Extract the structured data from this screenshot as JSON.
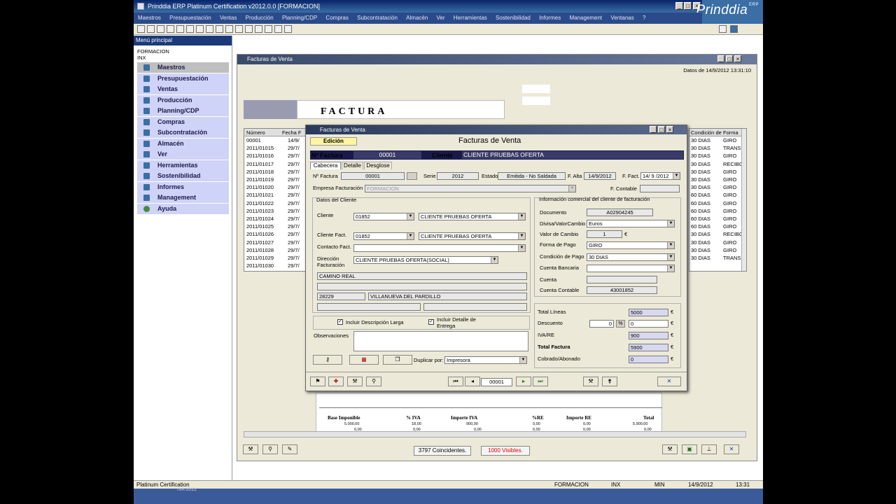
{
  "window": {
    "title": "Prinddia ERP Platinum Certification v2012.0.0 [FORMACION]"
  },
  "logo": {
    "text": "Prinddia",
    "sup": "ERP"
  },
  "menubar": [
    "Maestros",
    "Presupuestación",
    "Ventas",
    "Producción",
    "Planning/CDP",
    "Compras",
    "Subcontratación",
    "Almacén",
    "Ver",
    "Herramientas",
    "Sostenibilidad",
    "Informes",
    "Management",
    "Ventanas",
    "?"
  ],
  "sidemenu": {
    "header": "Menú principal",
    "company": "FORMACION",
    "user": "INX",
    "items": [
      "Maestros",
      "Presupuestación",
      "Ventas",
      "Producción",
      "Planning/CDP",
      "Compras",
      "Subcontratación",
      "Almacén",
      "Ver",
      "Herramientas",
      "Sostenibilidad",
      "Informes",
      "Management",
      "Ayuda"
    ]
  },
  "facturas_window": {
    "title": "Facturas de Venta",
    "date_label": "Datos de 14/9/2012 13:31:10",
    "doc_heading": "FACTURA",
    "columns": {
      "numero": "Número",
      "fecha": "Fecha F",
      "condicion": "Condición de",
      "forma": "Forma"
    },
    "numeros": [
      "00001",
      "2011/01015",
      "2011/01016",
      "2011/01017",
      "2011/01018",
      "2011/01019",
      "2011/01020",
      "2011/01021",
      "2011/01022",
      "2011/01023",
      "2011/01024",
      "2011/01025",
      "2011/01026",
      "2011/01027",
      "2011/01028",
      "2011/01029",
      "2011/01030"
    ],
    "fechas": [
      "14/9/",
      "29/7/",
      "29/7/",
      "29/7/",
      "29/7/",
      "29/7/",
      "29/7/",
      "29/7/",
      "29/7/",
      "29/7/",
      "29/7/",
      "29/7/",
      "29/7/",
      "29/7/",
      "29/7/",
      "29/7/",
      "29/7/"
    ],
    "condiciones": [
      "30 DIAS",
      "30 DIAS",
      "30 DIAS",
      "30 DIAS",
      "30 DIAS",
      "30 DIAS",
      "30 DIAS",
      "60 DIAS",
      "60 DIAS",
      "60 DIAS",
      "60 DIAS",
      "60 DIAS",
      "30 DIAS",
      "30 DIAS",
      "30 DIAS",
      "30 DIAS"
    ],
    "formas": [
      "GIRO",
      "TRANS",
      "GIRO",
      "RECIBO",
      "GIRO",
      "GIRO",
      "GIRO",
      "GIRO",
      "GIRO",
      "GIRO",
      "GIRO",
      "GIRO",
      "RECIBO",
      "GIRO",
      "GIRO",
      "TRANS"
    ],
    "totals": {
      "headers": [
        "Base Imponible",
        "% IVA",
        "Importe IVA",
        "%RE",
        "Importe RE",
        "Total"
      ],
      "row1": [
        "5.000,00",
        "18,00",
        "900,00",
        "0,00",
        "0,00",
        "5.900,00"
      ],
      "row2": [
        "0,00",
        "0,00",
        "0,00",
        "0,00",
        "0,00",
        "0,00"
      ]
    },
    "coincidentes": "3797 Coincidentes.",
    "visibles": "1000 Visibles."
  },
  "dialog": {
    "title": "Facturas de Venta",
    "header_title": "Facturas de Venta",
    "mode": "Edición",
    "nfactura_label": "Nº Factura",
    "nfactura": "00001",
    "cliente_label": "Cliente",
    "cliente": "CLIENTE PRUEBAS OFERTA",
    "tabs": [
      "Cabecera",
      "Detalle",
      "Desglose"
    ],
    "fields": {
      "nfactura_label": "Nº Factura",
      "nfactura": "00001",
      "serie_label": "Serie",
      "serie": "2012",
      "estado_label": "Estado",
      "estado": "Emitida - No Saldada",
      "falta_label": "F. Alta",
      "falta": "14/9/2012",
      "ffact_label": "F. Fact.",
      "ffact": "14/ 9 /2012",
      "empresa_label": "Empresa Facturación",
      "empresa": "FORMACION",
      "fcontable_label": "F. Contable"
    },
    "datos_cliente": {
      "title": "Datos del Cliente",
      "cliente_label": "Cliente",
      "cliente_code": "01852",
      "cliente_name": "CLIENTE PRUEBAS OFERTA",
      "clientefact_label": "Cliente Fact.",
      "clientefact_code": "01852",
      "clientefact_name": "CLIENTE PRUEBAS OFERTA",
      "contacto_label": "Contacto Fact.",
      "direccion_label1": "Dirección",
      "direccion_label2": "Facturación",
      "direccion": "CLIENTE PRUEBAS OFERTA(SOCIAL)",
      "calle": "CAMINO REAL",
      "cp": "28229",
      "poblacion": "VILLANUEVA DEL PARDILLO"
    },
    "info_comercial": {
      "title": "Información comercial del cliente de facturación",
      "documento_label": "Documento",
      "documento": "A02904245",
      "divisa_label": "Divisa/ValorCambio",
      "divisa": "Euros",
      "valor_label": "Valor de Cambio",
      "valor": "1",
      "valor_unit": "€",
      "forma_label": "Forma de Pago",
      "forma": "GIRO",
      "condicion_label": "Condición de Pago",
      "condicion": "30 DIAS",
      "banco_label": "Cuenta Bancaria",
      "cuenta_label": "Cuenta",
      "contable_label": "Cuenta Contable",
      "contable": "43001852"
    },
    "checks": {
      "desc_larga": "Incluir Descripción Larga",
      "detalle_1": "Incluir Detalle de",
      "detalle_2": "Entrega"
    },
    "observaciones_label": "Observaciones",
    "duplicar_label": "Duplicar por:",
    "duplicar": "Impresora",
    "totals": {
      "lineas_label": "Total Líneas",
      "lineas": "5000",
      "descuento_label": "Descuento",
      "descuento_pct": "0",
      "pct_sign": "%",
      "descuento": "0",
      "ivare_label": "IVA/RE",
      "ivare": "900",
      "total_label": "Total Factura",
      "total": "5900",
      "cobrado_label": "Cobrado/Abonado",
      "cobrado": "0",
      "euro": "€"
    },
    "nav_record": "00001"
  },
  "statusbar": {
    "left": "Platinum Certification",
    "empresa": "FORMACION",
    "user": "INX",
    "mode": "MIN",
    "date": "14/9/2012",
    "time": "13:31"
  },
  "taskbar": {
    "text": "IVA 2012"
  },
  "colors": {
    "title_blue": "#0a246a",
    "menu_lilac": "#cfd3f7",
    "field_lilac": "#d8d8f0",
    "dark_band": "#1a1a4a"
  }
}
